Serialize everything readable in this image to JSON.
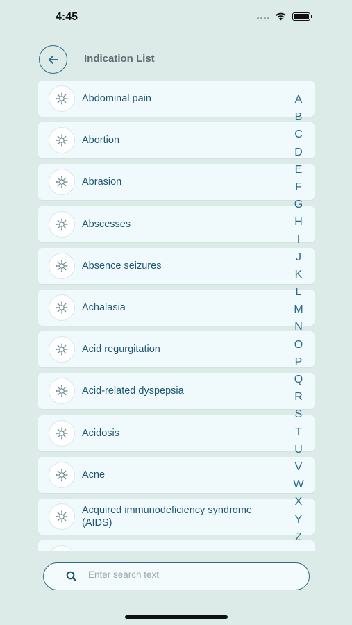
{
  "status_bar": {
    "time": "4:45"
  },
  "header": {
    "title": "Indication List"
  },
  "items": [
    {
      "label": "Abdominal pain"
    },
    {
      "label": "Abortion"
    },
    {
      "label": "Abrasion"
    },
    {
      "label": "Abscesses"
    },
    {
      "label": "Absence seizures"
    },
    {
      "label": "Achalasia"
    },
    {
      "label": "Acid regurgitation"
    },
    {
      "label": "Acid-related dyspepsia"
    },
    {
      "label": "Acidosis"
    },
    {
      "label": "Acne"
    },
    {
      "label": "Acquired immunodeficiency syndrome (AIDS)"
    },
    {
      "label": ""
    }
  ],
  "alphabet": [
    "A",
    "B",
    "C",
    "D",
    "E",
    "F",
    "G",
    "H",
    "I",
    "J",
    "K",
    "L",
    "M",
    "N",
    "O",
    "P",
    "Q",
    "R",
    "S",
    "T",
    "U",
    "V",
    "W",
    "X",
    "Y",
    "Z"
  ],
  "search": {
    "placeholder": "Enter search text",
    "value": ""
  },
  "colors": {
    "accent": "#2d6b88",
    "background": "#dcebe8",
    "card": "#f0fafc",
    "text": "#1e5670"
  },
  "icons": {
    "back": "arrow-left-icon",
    "item": "virus-cell-icon",
    "search": "search-icon"
  }
}
